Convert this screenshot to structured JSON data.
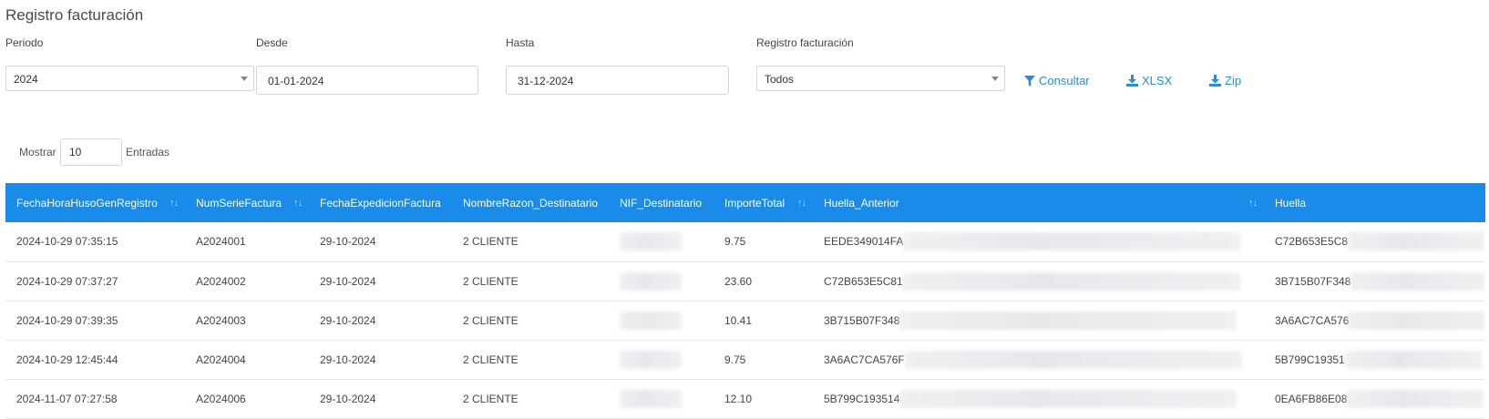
{
  "page": {
    "title": "Registro facturación"
  },
  "filters": {
    "periodo": {
      "label": "Periodo",
      "value": "2024"
    },
    "desde": {
      "label": "Desde",
      "value": "01-01-2024"
    },
    "hasta": {
      "label": "Hasta",
      "value": "31-12-2024"
    },
    "registro": {
      "label": "Registro facturación",
      "value": "Todos"
    }
  },
  "actions": {
    "consultar": "Consultar",
    "xlsx": "XLSX",
    "zip": "Zip"
  },
  "length_control": {
    "prefix": "Mostrar",
    "value": "10",
    "suffix": "Entradas"
  },
  "table": {
    "columns": [
      "FechaHoraHusoGenRegistro",
      "NumSerieFactura",
      "FechaExpedicionFactura",
      "NombreRazon_Destinatario",
      "NIF_Destinatario",
      "ImporteTotal",
      "Huella_Anterior",
      "Huella"
    ],
    "rows": [
      {
        "fecha_hora": "2024-10-29 07:35:15",
        "num_serie": "A2024001",
        "fecha_exp": "29-10-2024",
        "nombre": "2 CLIENTE",
        "importe": "9.75",
        "huella_anterior": "EEDE349014FA",
        "huella": "C72B653E5C8"
      },
      {
        "fecha_hora": "2024-10-29 07:37:27",
        "num_serie": "A2024002",
        "fecha_exp": "29-10-2024",
        "nombre": "2 CLIENTE",
        "importe": "23.60",
        "huella_anterior": "C72B653E5C81",
        "huella": "3B715B07F348"
      },
      {
        "fecha_hora": "2024-10-29 07:39:35",
        "num_serie": "A2024003",
        "fecha_exp": "29-10-2024",
        "nombre": "2 CLIENTE",
        "importe": "10.41",
        "huella_anterior": "3B715B07F348",
        "huella": "3A6AC7CA576"
      },
      {
        "fecha_hora": "2024-10-29 12:45:44",
        "num_serie": "A2024004",
        "fecha_exp": "29-10-2024",
        "nombre": "2 CLIENTE",
        "importe": "9.75",
        "huella_anterior": "3A6AC7CA576F",
        "huella": "5B799C19351"
      },
      {
        "fecha_hora": "2024-11-07 07:27:58",
        "num_serie": "A2024006",
        "fecha_exp": "29-10-2024",
        "nombre": "2 CLIENTE",
        "importe": "12.10",
        "huella_anterior": "5B799C193514",
        "huella": "0EA6FB86E08"
      }
    ]
  },
  "colors": {
    "header_bg": "#1a8be8",
    "link": "#2a8bd6"
  }
}
